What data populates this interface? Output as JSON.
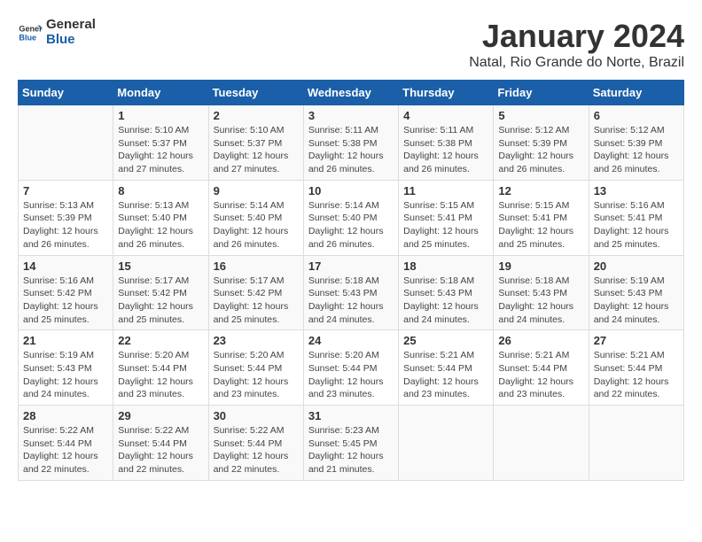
{
  "header": {
    "logo_line1": "General",
    "logo_line2": "Blue",
    "title": "January 2024",
    "subtitle": "Natal, Rio Grande do Norte, Brazil"
  },
  "calendar": {
    "days_of_week": [
      "Sunday",
      "Monday",
      "Tuesday",
      "Wednesday",
      "Thursday",
      "Friday",
      "Saturday"
    ],
    "weeks": [
      [
        {
          "day": "",
          "info": ""
        },
        {
          "day": "1",
          "info": "Sunrise: 5:10 AM\nSunset: 5:37 PM\nDaylight: 12 hours and 27 minutes."
        },
        {
          "day": "2",
          "info": "Sunrise: 5:10 AM\nSunset: 5:37 PM\nDaylight: 12 hours and 27 minutes."
        },
        {
          "day": "3",
          "info": "Sunrise: 5:11 AM\nSunset: 5:38 PM\nDaylight: 12 hours and 26 minutes."
        },
        {
          "day": "4",
          "info": "Sunrise: 5:11 AM\nSunset: 5:38 PM\nDaylight: 12 hours and 26 minutes."
        },
        {
          "day": "5",
          "info": "Sunrise: 5:12 AM\nSunset: 5:39 PM\nDaylight: 12 hours and 26 minutes."
        },
        {
          "day": "6",
          "info": "Sunrise: 5:12 AM\nSunset: 5:39 PM\nDaylight: 12 hours and 26 minutes."
        }
      ],
      [
        {
          "day": "7",
          "info": "Sunrise: 5:13 AM\nSunset: 5:39 PM\nDaylight: 12 hours and 26 minutes."
        },
        {
          "day": "8",
          "info": "Sunrise: 5:13 AM\nSunset: 5:40 PM\nDaylight: 12 hours and 26 minutes."
        },
        {
          "day": "9",
          "info": "Sunrise: 5:14 AM\nSunset: 5:40 PM\nDaylight: 12 hours and 26 minutes."
        },
        {
          "day": "10",
          "info": "Sunrise: 5:14 AM\nSunset: 5:40 PM\nDaylight: 12 hours and 26 minutes."
        },
        {
          "day": "11",
          "info": "Sunrise: 5:15 AM\nSunset: 5:41 PM\nDaylight: 12 hours and 25 minutes."
        },
        {
          "day": "12",
          "info": "Sunrise: 5:15 AM\nSunset: 5:41 PM\nDaylight: 12 hours and 25 minutes."
        },
        {
          "day": "13",
          "info": "Sunrise: 5:16 AM\nSunset: 5:41 PM\nDaylight: 12 hours and 25 minutes."
        }
      ],
      [
        {
          "day": "14",
          "info": "Sunrise: 5:16 AM\nSunset: 5:42 PM\nDaylight: 12 hours and 25 minutes."
        },
        {
          "day": "15",
          "info": "Sunrise: 5:17 AM\nSunset: 5:42 PM\nDaylight: 12 hours and 25 minutes."
        },
        {
          "day": "16",
          "info": "Sunrise: 5:17 AM\nSunset: 5:42 PM\nDaylight: 12 hours and 25 minutes."
        },
        {
          "day": "17",
          "info": "Sunrise: 5:18 AM\nSunset: 5:43 PM\nDaylight: 12 hours and 24 minutes."
        },
        {
          "day": "18",
          "info": "Sunrise: 5:18 AM\nSunset: 5:43 PM\nDaylight: 12 hours and 24 minutes."
        },
        {
          "day": "19",
          "info": "Sunrise: 5:18 AM\nSunset: 5:43 PM\nDaylight: 12 hours and 24 minutes."
        },
        {
          "day": "20",
          "info": "Sunrise: 5:19 AM\nSunset: 5:43 PM\nDaylight: 12 hours and 24 minutes."
        }
      ],
      [
        {
          "day": "21",
          "info": "Sunrise: 5:19 AM\nSunset: 5:43 PM\nDaylight: 12 hours and 24 minutes."
        },
        {
          "day": "22",
          "info": "Sunrise: 5:20 AM\nSunset: 5:44 PM\nDaylight: 12 hours and 23 minutes."
        },
        {
          "day": "23",
          "info": "Sunrise: 5:20 AM\nSunset: 5:44 PM\nDaylight: 12 hours and 23 minutes."
        },
        {
          "day": "24",
          "info": "Sunrise: 5:20 AM\nSunset: 5:44 PM\nDaylight: 12 hours and 23 minutes."
        },
        {
          "day": "25",
          "info": "Sunrise: 5:21 AM\nSunset: 5:44 PM\nDaylight: 12 hours and 23 minutes."
        },
        {
          "day": "26",
          "info": "Sunrise: 5:21 AM\nSunset: 5:44 PM\nDaylight: 12 hours and 23 minutes."
        },
        {
          "day": "27",
          "info": "Sunrise: 5:21 AM\nSunset: 5:44 PM\nDaylight: 12 hours and 22 minutes."
        }
      ],
      [
        {
          "day": "28",
          "info": "Sunrise: 5:22 AM\nSunset: 5:44 PM\nDaylight: 12 hours and 22 minutes."
        },
        {
          "day": "29",
          "info": "Sunrise: 5:22 AM\nSunset: 5:44 PM\nDaylight: 12 hours and 22 minutes."
        },
        {
          "day": "30",
          "info": "Sunrise: 5:22 AM\nSunset: 5:44 PM\nDaylight: 12 hours and 22 minutes."
        },
        {
          "day": "31",
          "info": "Sunrise: 5:23 AM\nSunset: 5:45 PM\nDaylight: 12 hours and 21 minutes."
        },
        {
          "day": "",
          "info": ""
        },
        {
          "day": "",
          "info": ""
        },
        {
          "day": "",
          "info": ""
        }
      ]
    ]
  }
}
